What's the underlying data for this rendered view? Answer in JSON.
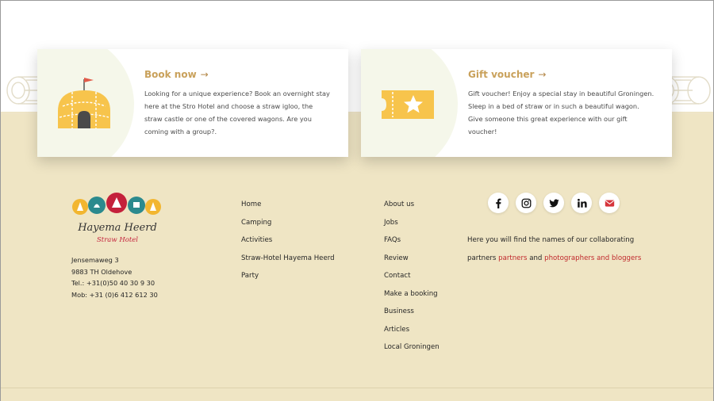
{
  "cards": [
    {
      "title": "Book now",
      "arrow": "→",
      "text": "Looking for a unique experience? Book an overnight stay here at the Stro Hotel and choose a straw igloo, the straw castle or one of the covered wagons. Are you coming with a group?."
    },
    {
      "title": "Gift voucher",
      "arrow": "→",
      "text": "Gift voucher! Enjoy a special stay in beautiful Groningen. Sleep in a bed of straw or in such a beautiful wagon. Give someone this great experience with our gift voucher!"
    }
  ],
  "logo": {
    "name": "Hayema Heerd",
    "subtitle": "Straw Hotel"
  },
  "address": {
    "street": "Jensemaweg 3",
    "city": "9883 TH Oldehove",
    "tel": "Tel.: +31(0)50 40 30 9 30",
    "mob": "Mob: +31 (0)6 412 612 30"
  },
  "nav1": [
    "Home",
    "Camping",
    "Activities",
    "Straw-Hotel Hayema Heerd",
    "Party"
  ],
  "nav2": [
    "About us",
    "Jobs",
    "FAQs",
    "Review",
    "Contact",
    "Make a booking",
    "Business",
    "Articles",
    "Local Groningen"
  ],
  "socials": [
    "facebook-icon",
    "instagram-icon",
    "twitter-icon",
    "linkedin-icon",
    "mail-icon"
  ],
  "partners": {
    "line1": "Here you will find the names of our collaborating",
    "line2_prefix": "partners",
    "link1": "partners",
    "and": "and",
    "link2": "photographers and bloggers"
  },
  "colors": {
    "accent": "#c9a15b",
    "link_red": "#c0282c",
    "beige": "#efe5c4",
    "mail_red": "#d6343b"
  }
}
